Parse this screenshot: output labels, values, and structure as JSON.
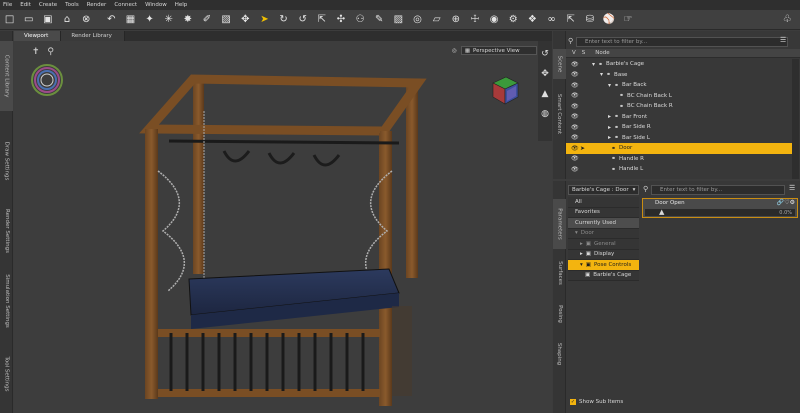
{
  "menu": [
    "File",
    "Edit",
    "Create",
    "Tools",
    "Render",
    "Connect",
    "Window",
    "Help"
  ],
  "toolbar_icons": [
    "new-file-icon",
    "open-folder-icon",
    "save-icon",
    "home-icon",
    "delete-icon",
    "undo-icon",
    "select-icon",
    "pose-tool-icon",
    "universal-tool-icon",
    "node-weight-icon",
    "translate-icon",
    "rotate-icon",
    "scale-icon",
    "joint-editor-icon",
    "spot-render-icon",
    "surface-selection-icon",
    "camera-cube-icon",
    "orbit-icon",
    "zoom-icon",
    "pan-icon",
    "render-icon",
    "render-settings-icon",
    "lock-icon",
    "unlock-icon",
    "share-icon"
  ],
  "left_tabs": [
    "Content Library",
    "Draw Settings",
    "Render Settings",
    "Simulation Settings",
    "Tool Settings"
  ],
  "viewport": {
    "tabs": [
      "Viewport",
      "Render Library"
    ],
    "camera": "Perspective View"
  },
  "right_top_tabs": [
    "Scene",
    "Smart Content"
  ],
  "right_bottom_tabs": [
    "Parameters",
    "Surfaces",
    "Posing",
    "Shaping"
  ],
  "scene": {
    "filter_placeholder": "Enter text to filter by...",
    "col_v": "V",
    "col_s": "S",
    "col_node": "Node",
    "nodes": [
      {
        "label": "Barbie's Cage",
        "depth": 0,
        "expander": "▾",
        "selected": false
      },
      {
        "label": "Base",
        "depth": 1,
        "expander": "▾",
        "selected": false
      },
      {
        "label": "Bar Back",
        "depth": 2,
        "expander": "▾",
        "selected": false
      },
      {
        "label": "BC Chain Back L",
        "depth": 3,
        "expander": "",
        "selected": false
      },
      {
        "label": "BC Chain Back R",
        "depth": 3,
        "expander": "",
        "selected": false
      },
      {
        "label": "Bar Front",
        "depth": 2,
        "expander": "▸",
        "selected": false
      },
      {
        "label": "Bar Side R",
        "depth": 2,
        "expander": "▸",
        "selected": false
      },
      {
        "label": "Bar Side L",
        "depth": 2,
        "expander": "▸",
        "selected": false
      },
      {
        "label": "Door",
        "depth": 2,
        "expander": "",
        "selected": true
      },
      {
        "label": "Handle R",
        "depth": 2,
        "expander": "",
        "selected": false
      },
      {
        "label": "Handle L",
        "depth": 2,
        "expander": "",
        "selected": false
      }
    ]
  },
  "parameters": {
    "node_dropdown": "Barbie's Cage : Door",
    "filter_placeholder": "Enter text to filter by...",
    "categories": [
      {
        "label": "All",
        "indent": 0,
        "expander": "",
        "state": "normal"
      },
      {
        "label": "Favorites",
        "indent": 0,
        "expander": "",
        "state": "normal"
      },
      {
        "label": "Currently Used",
        "indent": 0,
        "expander": "",
        "state": "highlight"
      },
      {
        "label": "Door",
        "indent": 0,
        "expander": "▾",
        "state": "dim"
      },
      {
        "label": "General",
        "indent": 1,
        "expander": "▸",
        "state": "dim"
      },
      {
        "label": "Display",
        "indent": 1,
        "expander": "▸",
        "state": "normal"
      },
      {
        "label": "Pose Controls",
        "indent": 1,
        "expander": "▾",
        "state": "selected"
      },
      {
        "label": "Barbie's Cage",
        "indent": 2,
        "expander": "",
        "state": "normal"
      }
    ],
    "property": {
      "name": "Door Open",
      "value": "0.0%",
      "fraction": 0.0
    },
    "show_sub_items": "Show Sub Items",
    "show_sub_items_checked": true
  },
  "colors": {
    "accent": "#f3b40f",
    "panel": "#383838",
    "viewport_bg": "#3d3d3d"
  }
}
